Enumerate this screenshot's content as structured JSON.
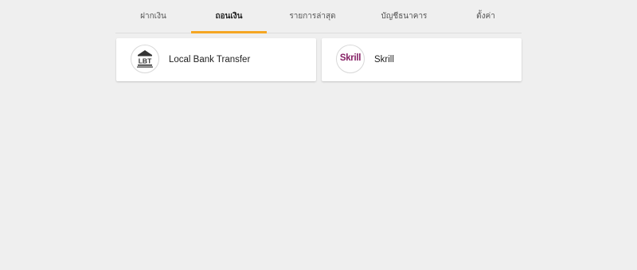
{
  "tabs": [
    {
      "label": "ฝากเงิน",
      "active": false
    },
    {
      "label": "ถอนเงิน",
      "active": true
    },
    {
      "label": "รายการล่าสุด",
      "active": false
    },
    {
      "label": "บัญชีธนาคาร",
      "active": false
    },
    {
      "label": "ตั้งค่า",
      "active": false
    }
  ],
  "methods": [
    {
      "label": "Local Bank Transfer",
      "logo_text": "LBT",
      "icon": "bank-icon"
    },
    {
      "label": "Skrill",
      "logo_text": "Skrill",
      "icon": "skrill-logo-icon",
      "brand_color": "#862165"
    }
  ],
  "colors": {
    "accent": "#f5a623",
    "background": "#efefef"
  }
}
